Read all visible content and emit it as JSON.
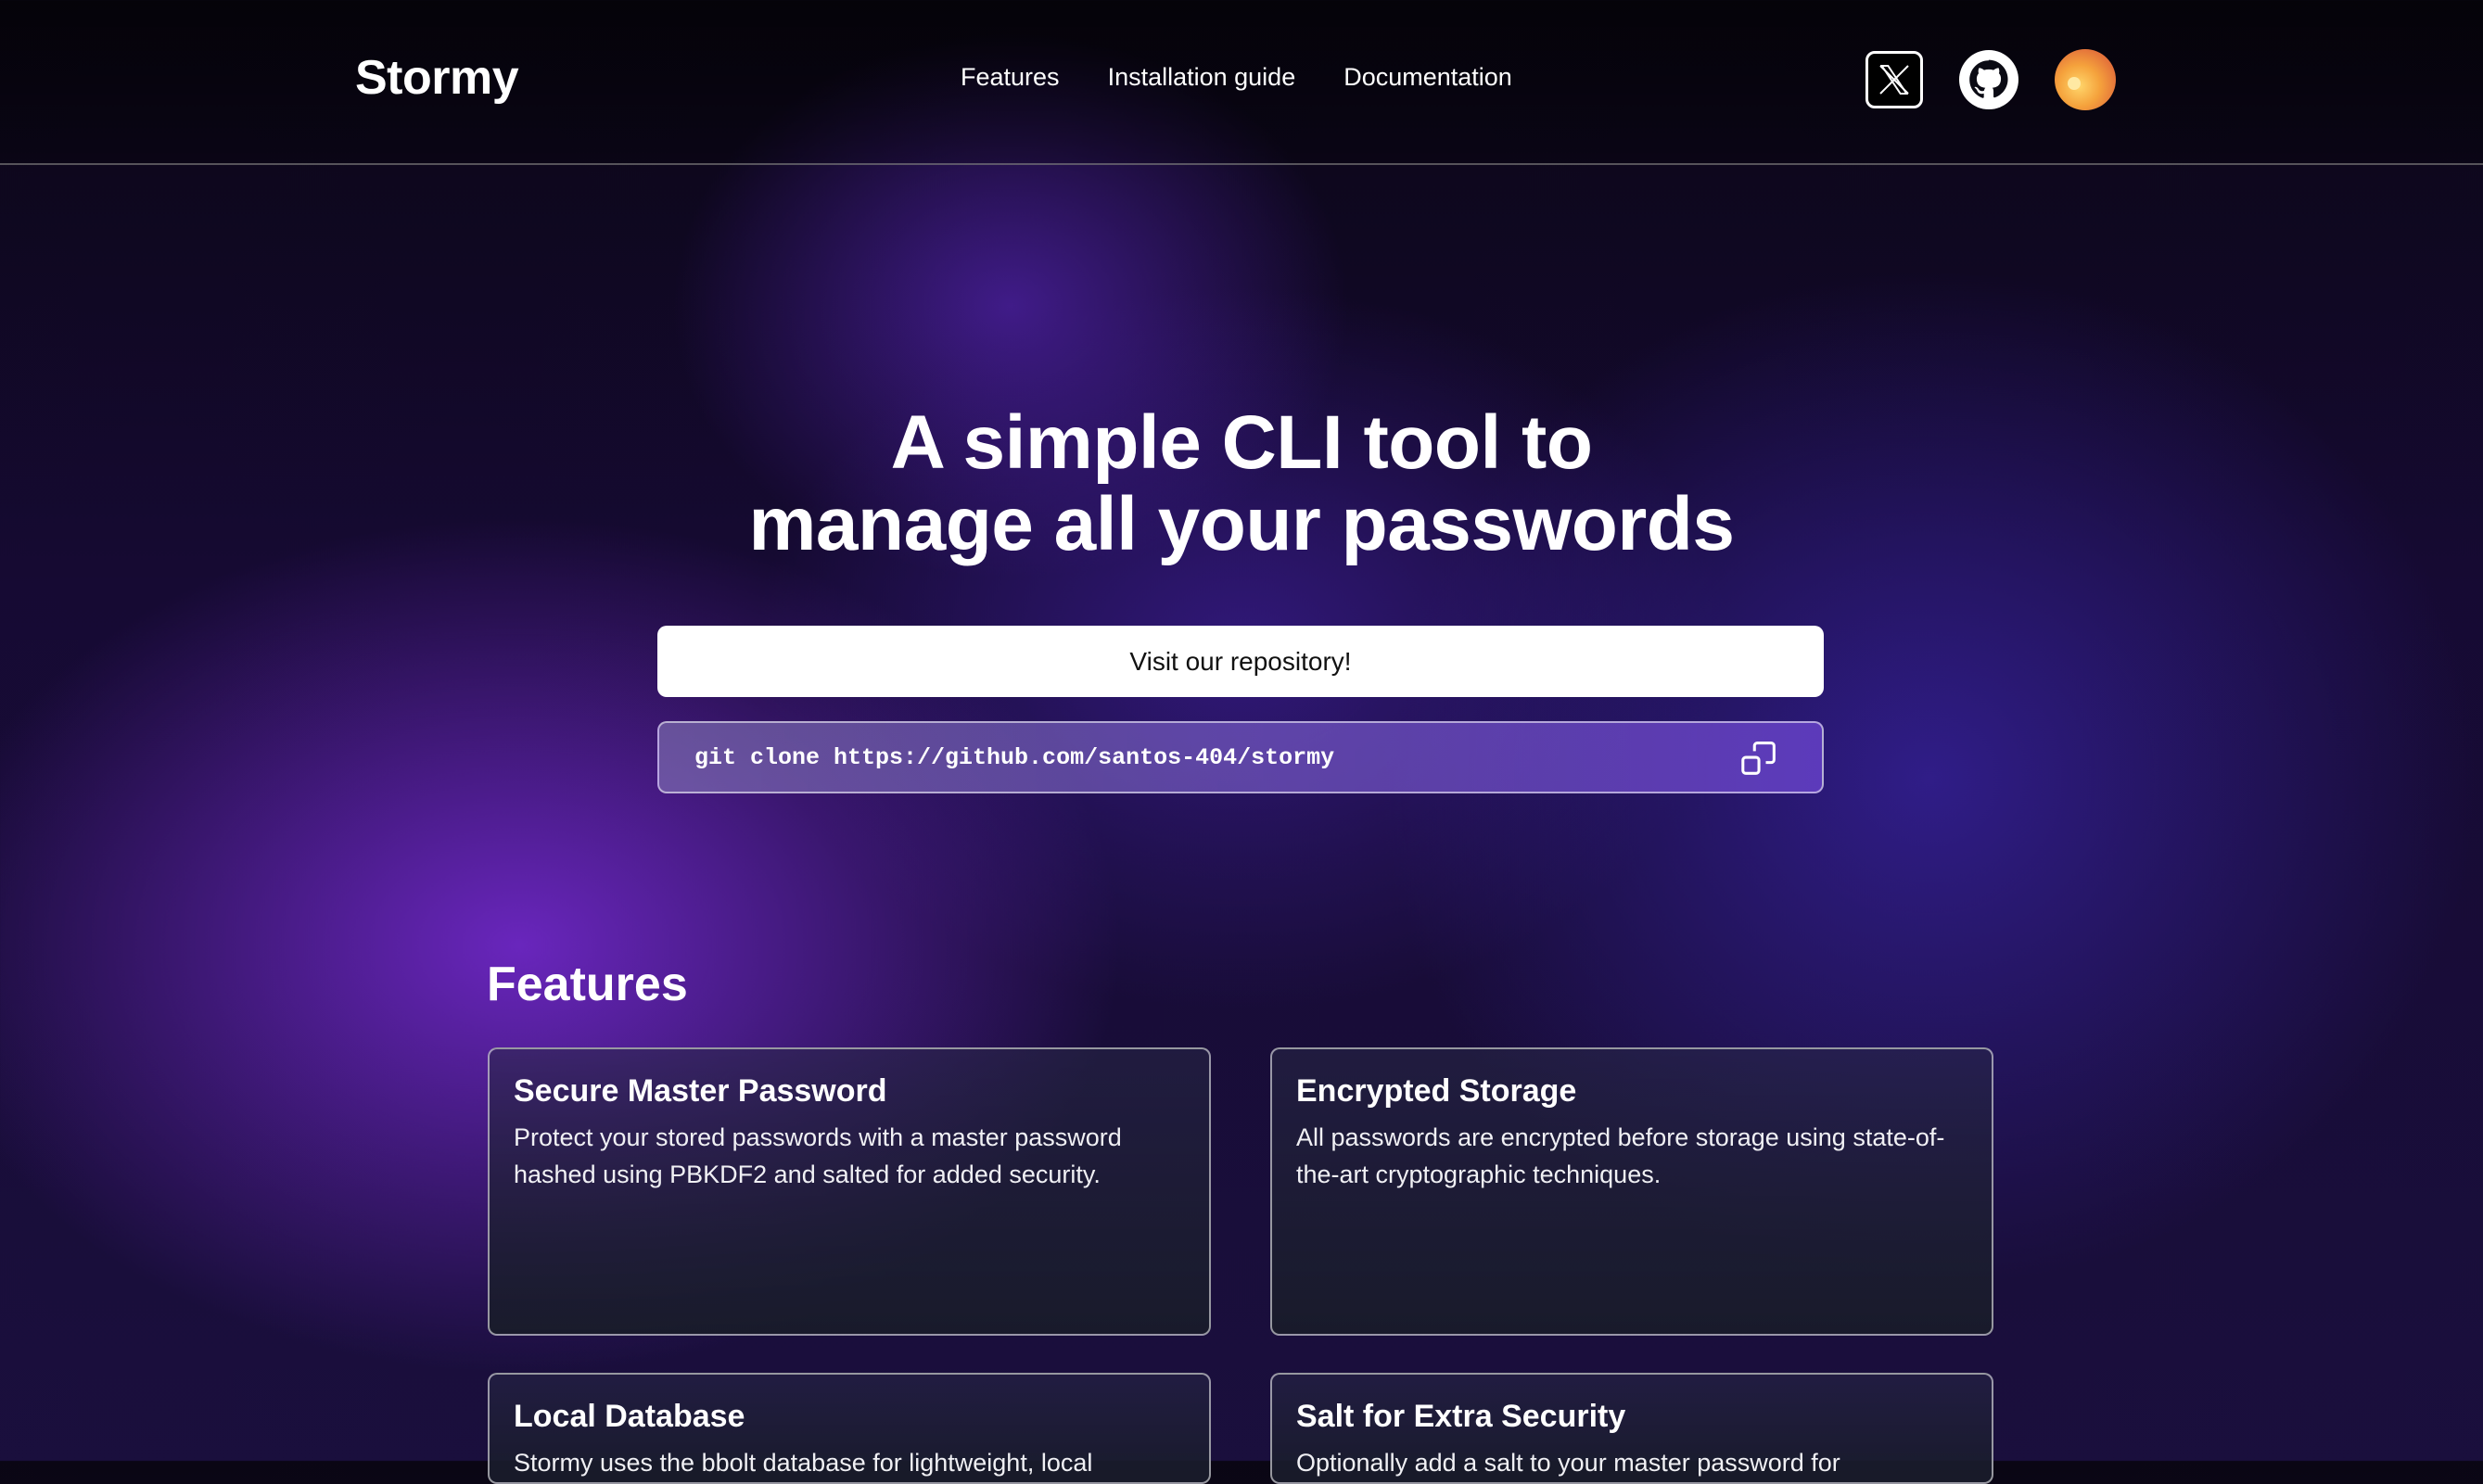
{
  "brand": "Stormy",
  "nav": {
    "links": [
      "Features",
      "Installation guide",
      "Documentation"
    ],
    "icons": [
      "x-twitter-icon",
      "github-icon",
      "avatar"
    ]
  },
  "hero": {
    "title_line1": "A simple CLI tool to",
    "title_line2": "manage all your passwords",
    "repo_button": "Visit our repository!",
    "clone_command": "git clone https://github.com/santos-404/stormy"
  },
  "features": {
    "title": "Features",
    "cards": [
      {
        "title": "Secure Master Password",
        "description": "Protect your stored passwords with a master password hashed using PBKDF2 and salted for added security."
      },
      {
        "title": "Encrypted Storage",
        "description": "All passwords are encrypted before storage using state-of-the-art cryptographic techniques."
      },
      {
        "title": "Local Database",
        "description": "Stormy uses the bbolt database for lightweight, local"
      },
      {
        "title": "Salt for Extra Security",
        "description": "Optionally add a salt to your master password for"
      }
    ]
  },
  "colors": {
    "background_dark": "#0a0614",
    "accent_purple": "#6a2ccc",
    "card_bg": "#1c1f2e"
  }
}
